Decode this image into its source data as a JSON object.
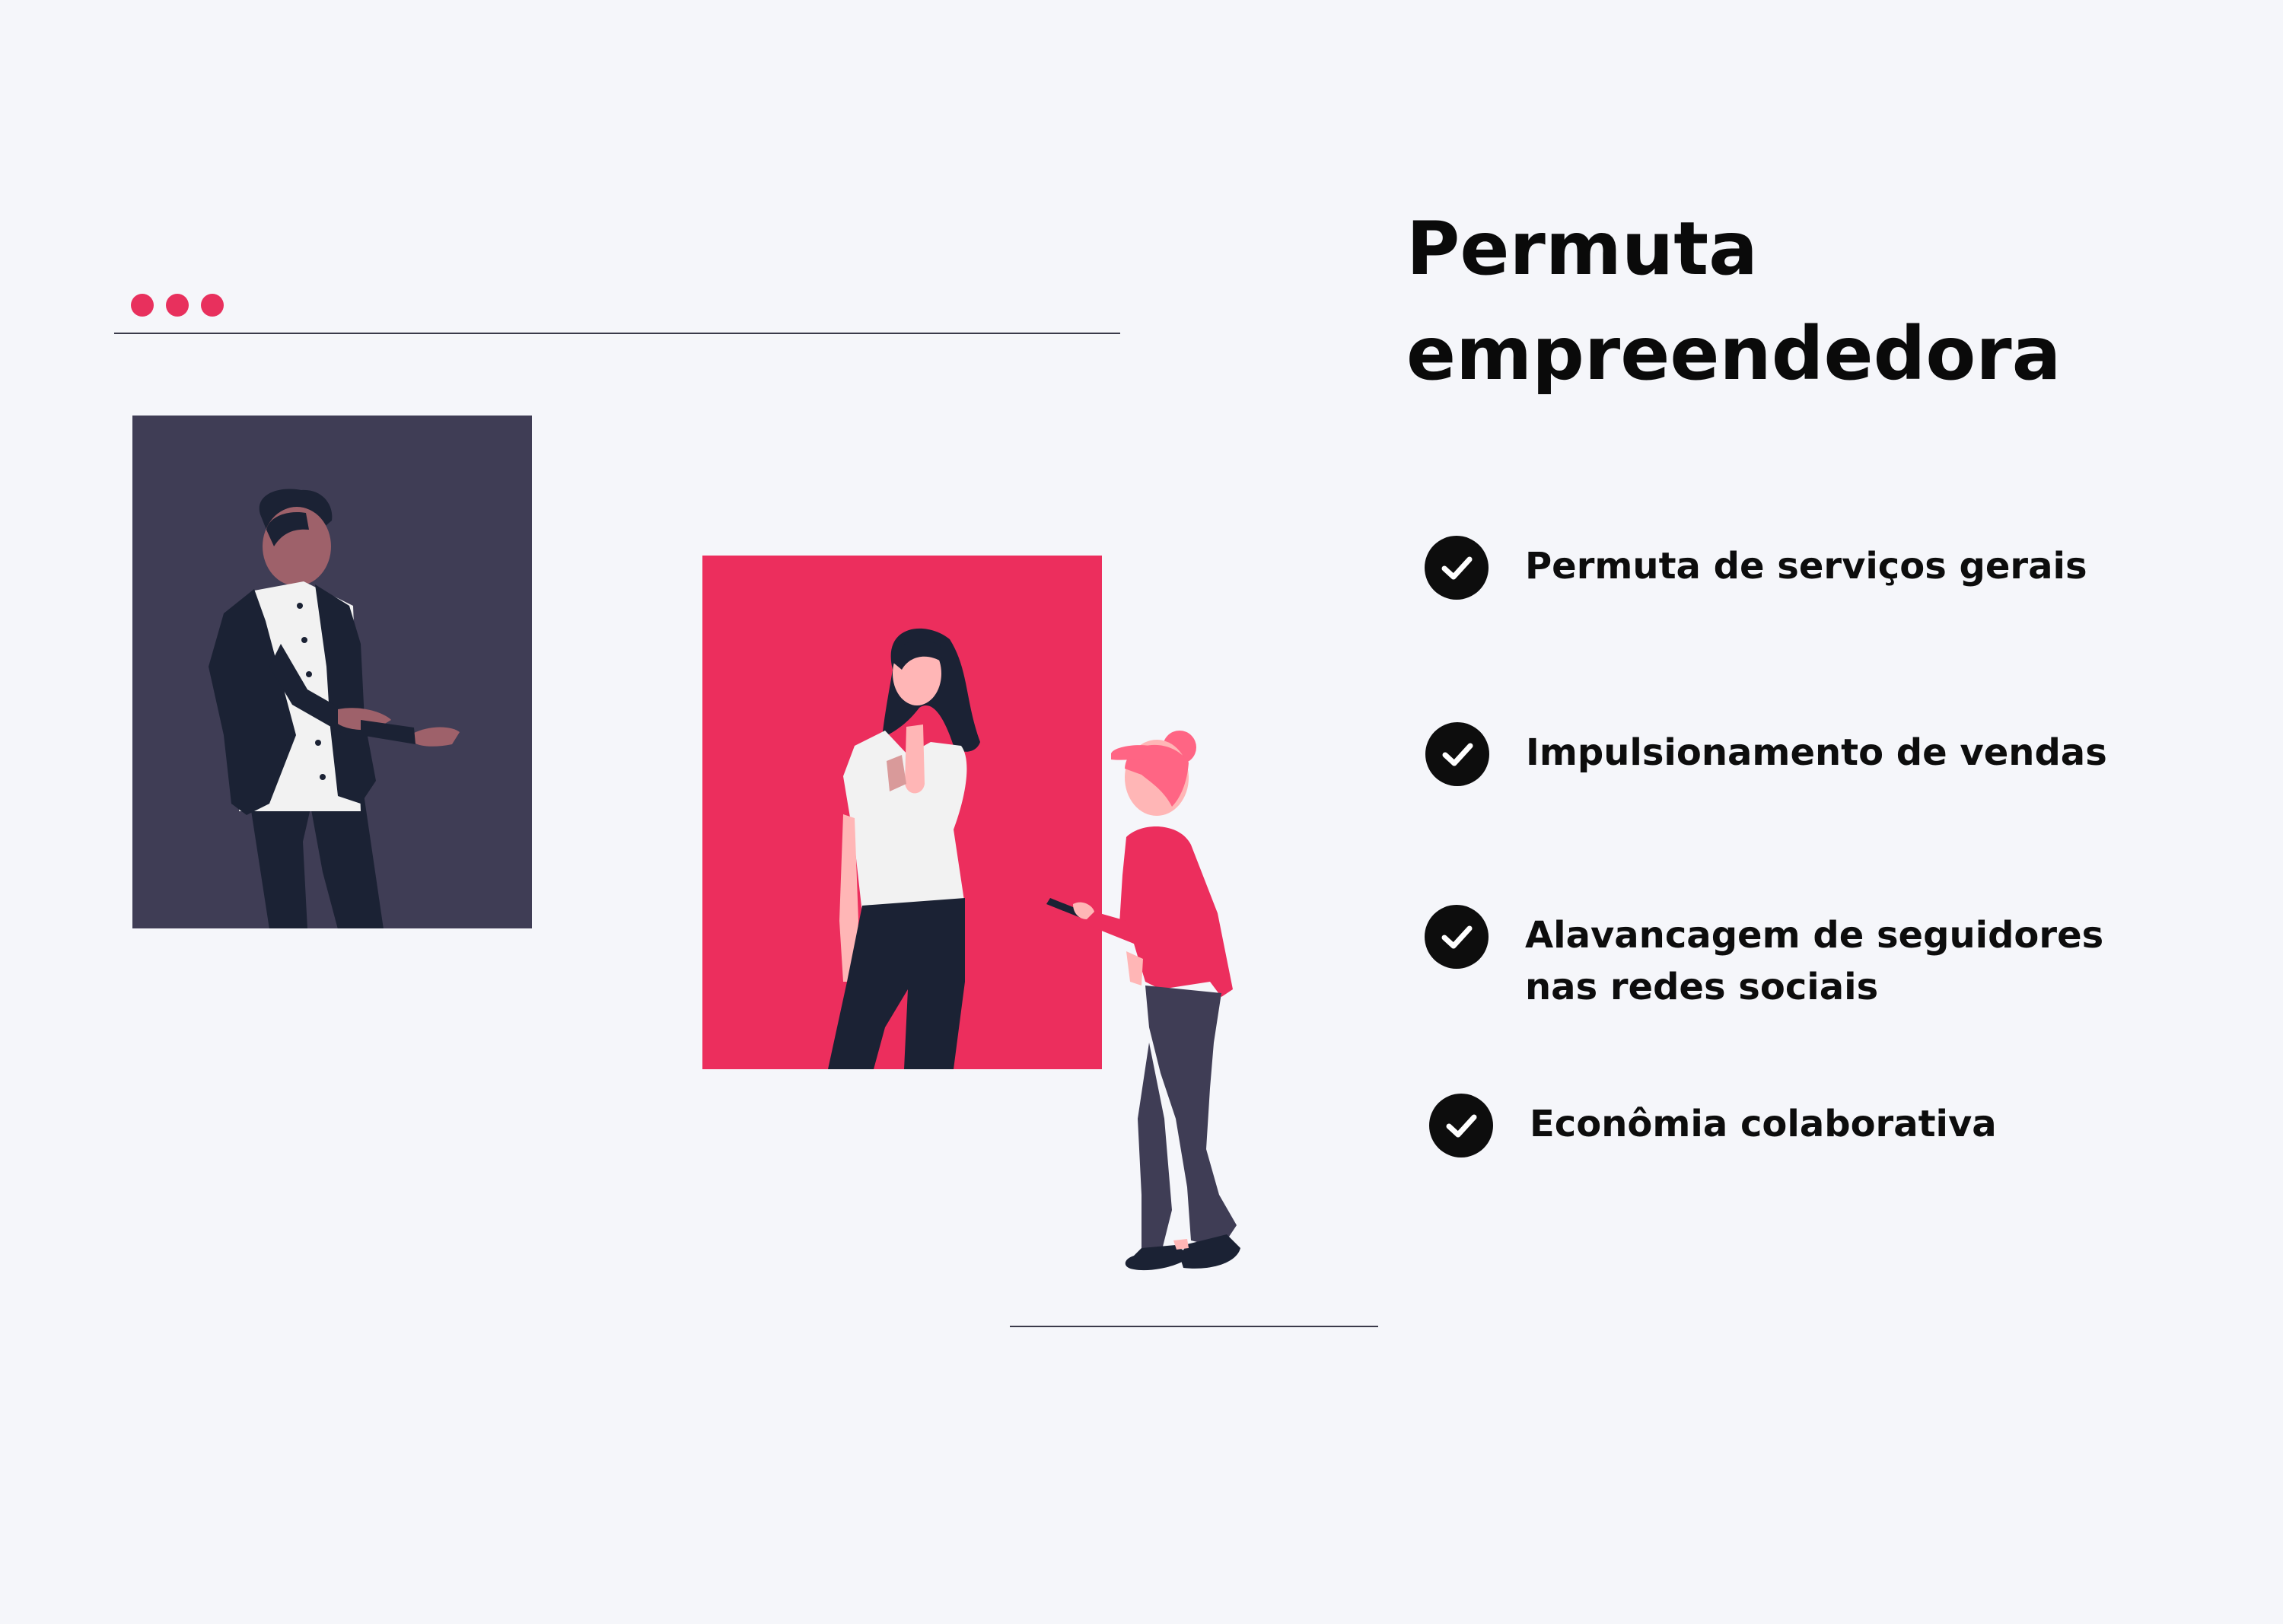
{
  "header": {
    "dots": [
      "red",
      "red",
      "red"
    ]
  },
  "title": {
    "line1": "Permuta",
    "line2": "empreendedora"
  },
  "features": [
    {
      "label": "Permuta de serviços gerais",
      "icon": "check-circle-icon"
    },
    {
      "label": "Impulsionamento de vendas",
      "icon": "check-circle-icon"
    },
    {
      "label": "Alavancagem de seguidores nas redes sociais",
      "icon": "check-circle-icon"
    },
    {
      "label": "Econômia colaborativa",
      "icon": "check-circle-icon"
    }
  ],
  "colors": {
    "background": "#f5f6fa",
    "accent": "#ec2e5d",
    "dark_frame": "#3f3d55",
    "text": "#0a0a0a"
  }
}
